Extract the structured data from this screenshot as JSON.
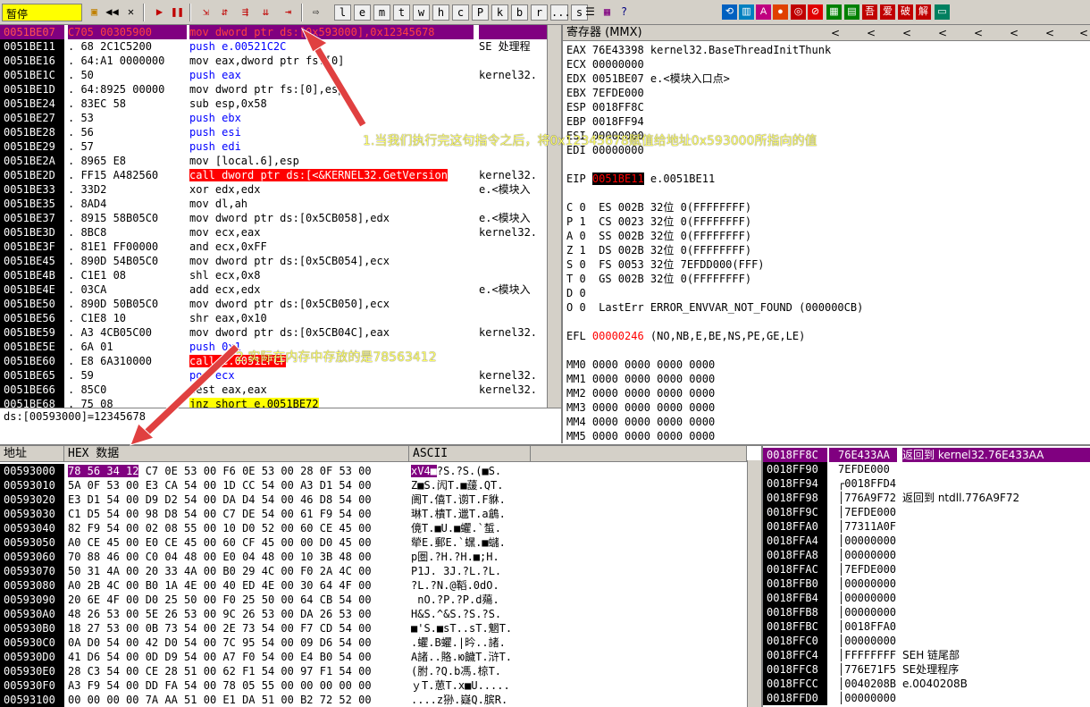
{
  "toolbar": {
    "status": "暂停",
    "letters": [
      "l",
      "e",
      "m",
      "t",
      "w",
      "h",
      "c",
      "P",
      "k",
      "b",
      "r",
      "...",
      "s"
    ],
    "cn_buttons": [
      "吾",
      "爱",
      "破",
      "解"
    ]
  },
  "cpu": {
    "rows": [
      {
        "addr": "0051BE07",
        "hex": "C705 00305900",
        "ins": "mov dword ptr ds:[0x593000],0x12345678",
        "ins_color": "",
        "com": "",
        "sel": true
      },
      {
        "addr": "0051BE11",
        "hex": ". 68 2C1C5200",
        "ins": "push e.00521C2C",
        "ins_color": "blue",
        "com": "SE 处理程",
        "sel": false
      },
      {
        "addr": "0051BE16",
        "hex": ". 64:A1 0000000",
        "ins": "mov eax,dword ptr fs:[0]",
        "ins_color": "",
        "com": "",
        "sel": false
      },
      {
        "addr": "0051BE1C",
        "hex": ". 50",
        "ins": "push eax",
        "ins_color": "blue",
        "com": "kernel32.",
        "sel": false
      },
      {
        "addr": "0051BE1D",
        "hex": ". 64:8925 00000",
        "ins": "mov dword ptr fs:[0],esp",
        "ins_color": "",
        "com": "",
        "sel": false
      },
      {
        "addr": "0051BE24",
        "hex": ". 83EC 58",
        "ins": "sub esp,0x58",
        "ins_color": "",
        "com": "",
        "sel": false
      },
      {
        "addr": "0051BE27",
        "hex": ". 53",
        "ins": "push ebx",
        "ins_color": "blue",
        "com": "",
        "sel": false
      },
      {
        "addr": "0051BE28",
        "hex": ". 56",
        "ins": "push esi",
        "ins_color": "blue",
        "com": "",
        "sel": false
      },
      {
        "addr": "0051BE29",
        "hex": ". 57",
        "ins": "push edi",
        "ins_color": "blue",
        "com": "",
        "sel": false
      },
      {
        "addr": "0051BE2A",
        "hex": ". 8965 E8",
        "ins": "mov [local.6],esp",
        "ins_color": "",
        "com": "",
        "sel": false
      },
      {
        "addr": "0051BE2D",
        "hex": ". FF15 A482560",
        "ins": "call dword ptr ds:[<&KERNEL32.GetVersion",
        "ins_color": "call",
        "com": "kernel32.",
        "sel": false
      },
      {
        "addr": "0051BE33",
        "hex": ". 33D2",
        "ins": "xor edx,edx",
        "ins_color": "",
        "com": "e.<模块入",
        "sel": false
      },
      {
        "addr": "0051BE35",
        "hex": ". 8AD4",
        "ins": "mov dl,ah",
        "ins_color": "",
        "com": "",
        "sel": false
      },
      {
        "addr": "0051BE37",
        "hex": ". 8915 58B05C0",
        "ins": "mov dword ptr ds:[0x5CB058],edx",
        "ins_color": "",
        "com": "e.<模块入",
        "sel": false
      },
      {
        "addr": "0051BE3D",
        "hex": ". 8BC8",
        "ins": "mov ecx,eax",
        "ins_color": "",
        "com": "kernel32.",
        "sel": false
      },
      {
        "addr": "0051BE3F",
        "hex": ". 81E1 FF00000",
        "ins": "and ecx,0xFF",
        "ins_color": "",
        "com": "",
        "sel": false
      },
      {
        "addr": "0051BE45",
        "hex": ". 890D 54B05C0",
        "ins": "mov dword ptr ds:[0x5CB054],ecx",
        "ins_color": "",
        "com": "",
        "sel": false
      },
      {
        "addr": "0051BE4B",
        "hex": ". C1E1 08",
        "ins": "shl ecx,0x8",
        "ins_color": "",
        "com": "",
        "sel": false
      },
      {
        "addr": "0051BE4E",
        "hex": ". 03CA",
        "ins": "add ecx,edx",
        "ins_color": "",
        "com": "e.<模块入",
        "sel": false
      },
      {
        "addr": "0051BE50",
        "hex": ". 890D 50B05C0",
        "ins": "mov dword ptr ds:[0x5CB050],ecx",
        "ins_color": "",
        "com": "",
        "sel": false
      },
      {
        "addr": "0051BE56",
        "hex": ". C1E8 10",
        "ins": "shr eax,0x10",
        "ins_color": "",
        "com": "",
        "sel": false
      },
      {
        "addr": "0051BE59",
        "hex": ". A3 4CB05C00",
        "ins": "mov dword ptr ds:[0x5CB04C],eax",
        "ins_color": "",
        "com": "kernel32.",
        "sel": false
      },
      {
        "addr": "0051BE5E",
        "hex": ". 6A 01",
        "ins": "push 0x1",
        "ins_color": "blue",
        "com": "",
        "sel": false
      },
      {
        "addr": "0051BE60",
        "hex": ". E8 6A310000",
        "ins": "call e.0051EFCF",
        "ins_color": "call",
        "com": "",
        "sel": false
      },
      {
        "addr": "0051BE65",
        "hex": ". 59",
        "ins": "pop ecx",
        "ins_color": "blue",
        "com": "kernel32.",
        "sel": false
      },
      {
        "addr": "0051BE66",
        "hex": ". 85C0",
        "ins": "test eax,eax",
        "ins_color": "",
        "com": "kernel32.",
        "sel": false
      },
      {
        "addr": "0051BE68",
        "hex": ". 75 08",
        "ins": "jnz short e.0051BE72",
        "ins_color": "jmp",
        "com": "",
        "sel": false
      }
    ],
    "info": "ds:[00593000]=12345678"
  },
  "registers": {
    "title": "寄存器 (MMX)",
    "lines": [
      {
        "text": "EAX 76E43398 kernel32.BaseThreadInitThunk",
        "red": ""
      },
      {
        "text": "ECX 00000000",
        "red": ""
      },
      {
        "text": "EDX 0051BE07 e.<模块入口点>",
        "red": ""
      },
      {
        "text": "EBX 7EFDE000",
        "red": ""
      },
      {
        "text": "ESP 0018FF8C",
        "red": ""
      },
      {
        "text": "EBP 0018FF94",
        "red": ""
      },
      {
        "text": "ESI 00000000",
        "red": ""
      },
      {
        "text": "EDI 00000000",
        "red": ""
      },
      {
        "text": "",
        "red": ""
      },
      {
        "text": "EIP 0051BE11 e.0051BE11",
        "red": "eip"
      },
      {
        "text": "",
        "red": ""
      },
      {
        "text": "C 0  ES 002B 32位 0(FFFFFFFF)",
        "red": ""
      },
      {
        "text": "P 1  CS 0023 32位 0(FFFFFFFF)",
        "red": ""
      },
      {
        "text": "A 0  SS 002B 32位 0(FFFFFFFF)",
        "red": ""
      },
      {
        "text": "Z 1  DS 002B 32位 0(FFFFFFFF)",
        "red": ""
      },
      {
        "text": "S 0  FS 0053 32位 7EFDD000(FFF)",
        "red": ""
      },
      {
        "text": "T 0  GS 002B 32位 0(FFFFFFFF)",
        "red": ""
      },
      {
        "text": "D 0",
        "red": ""
      },
      {
        "text": "O 0  LastErr ERROR_ENVVAR_NOT_FOUND (000000CB)",
        "red": ""
      },
      {
        "text": "",
        "red": ""
      },
      {
        "text": "EFL 00000246 (NO,NB,E,BE,NS,PE,GE,LE)",
        "red": "efl"
      },
      {
        "text": "",
        "red": ""
      },
      {
        "text": "MM0 0000 0000 0000 0000",
        "red": ""
      },
      {
        "text": "MM1 0000 0000 0000 0000",
        "red": ""
      },
      {
        "text": "MM2 0000 0000 0000 0000",
        "red": ""
      },
      {
        "text": "MM3 0000 0000 0000 0000",
        "red": ""
      },
      {
        "text": "MM4 0000 0000 0000 0000",
        "red": ""
      },
      {
        "text": "MM5 0000 0000 0000 0000",
        "red": ""
      },
      {
        "text": "MM6 0000 0000 0000 0000",
        "red": ""
      },
      {
        "text": "MM7 0000 0000 0000 0000",
        "red": ""
      }
    ]
  },
  "dump": {
    "headers": {
      "addr": "地址",
      "hex": "HEX 数据",
      "ascii": "ASCII"
    },
    "rows": [
      {
        "addr": "00593000",
        "hex": "78 56 34 12 C7 0E 53 00 F6 0E 53 00 28 0F 53 00",
        "ascii": "xV4■?S.?S.(■S."
      },
      {
        "addr": "00593010",
        "hex": "5A 0F 53 00 E3 CA 54 00 1D CC 54 00 A3 D1 54 00",
        "ascii": "Z■S.闶T.■蘐.QT."
      },
      {
        "addr": "00593020",
        "hex": "E3 D1 54 00 D9 D2 54 00 DA D4 54 00 46 D8 54 00",
        "ascii": "阓T.僖T.谫T.F貅."
      },
      {
        "addr": "00593030",
        "hex": "C1 D5 54 00 98 D8 54 00 C7 DE 54 00 61 F9 54 00",
        "ascii": "琳T.樻T.邋T.a鶬."
      },
      {
        "addr": "00593040",
        "hex": "82 F9 54 00 02 08 55 00 10 D0 52 00 60 CE 45 00",
        "ascii": "傹T.■U.■蠷.`蜤."
      },
      {
        "addr": "00593050",
        "hex": "A0 CE 45 00 E0 CE 45 00 60 CF 45 00 00 D0 45 00",
        "ascii": "犖E.郵E.`蟔.■蠩."
      },
      {
        "addr": "00593060",
        "hex": "70 88 46 00 C0 04 48 00 E0 04 48 00 10 3B 48 00",
        "ascii": "p圏.?H.?H.■;H."
      },
      {
        "addr": "00593070",
        "hex": "50 31 4A 00 20 33 4A 00 B0 29 4C 00 F0 2A 4C 00",
        "ascii": "P1J. 3J.?L.?L."
      },
      {
        "addr": "00593080",
        "hex": "A0 2B 4C 00 B0 1A 4E 00 40 ED 4E 00 30 64 4F 00",
        "ascii": "?L.?N.@鞱.0dO."
      },
      {
        "addr": "00593090",
        "hex": "20 6E 4F 00 D0 25 50 00 F0 25 50 00 64 CB 54 00",
        "ascii": " nO.?P.?P.d薚."
      },
      {
        "addr": "005930A0",
        "hex": "48 26 53 00 5E 26 53 00 9C 26 53 00 DA 26 53 00",
        "ascii": "H&S.^&S.?S.?S."
      },
      {
        "addr": "005930B0",
        "hex": "18 27 53 00 0B 73 54 00 2E 73 54 00 F7 CD 54 00",
        "ascii": "■'S.■sT..sT.魍T."
      },
      {
        "addr": "005930C0",
        "hex": "0A D0 54 00 42 D0 54 00 7C 95 54 00 09 D6 54 00",
        "ascii": ".蠷.B蠷.|昑..諸."
      },
      {
        "addr": "005930D0",
        "hex": "41 D6 54 00 0D D9 54 00 A7 F0 54 00 E4 B0 54 00",
        "ascii": "A諸..賂.ю饖T.浒T."
      },
      {
        "addr": "005930E0",
        "hex": "28 C3 54 00 CE 28 51 00 62 F1 54 00 97 F1 54 00",
        "ascii": "(胕.?Q.b馮.椋T."
      },
      {
        "addr": "005930F0",
        "hex": "A3 F9 54 00 DD FA 54 00 78 05 55 00 00 00 00 00",
        "ascii": "ｙT.葸T.x■U....."
      },
      {
        "addr": "00593100",
        "hex": "00 00 00 00 7A AA 51 00 E1 DA 51 00 B2 72 52 00",
        "ascii": "....z狲.嶷Q.膑R."
      }
    ]
  },
  "stack": {
    "rows": [
      {
        "addr": "0018FF8C",
        "val": "76E433AA",
        "com": "返回到 kernel32.76E433AA",
        "top": true
      },
      {
        "addr": "0018FF90",
        "val": "7EFDE000",
        "com": "",
        "top": false
      },
      {
        "addr": "0018FF94",
        "val": "┌0018FFD4",
        "com": "",
        "top": false
      },
      {
        "addr": "0018FF98",
        "val": "│776A9F72",
        "com": "返回到 ntdll.776A9F72",
        "top": false
      },
      {
        "addr": "0018FF9C",
        "val": "│7EFDE000",
        "com": "",
        "top": false
      },
      {
        "addr": "0018FFA0",
        "val": "│77311A0F",
        "com": "",
        "top": false
      },
      {
        "addr": "0018FFA4",
        "val": "│00000000",
        "com": "",
        "top": false
      },
      {
        "addr": "0018FFA8",
        "val": "│00000000",
        "com": "",
        "top": false
      },
      {
        "addr": "0018FFAC",
        "val": "│7EFDE000",
        "com": "",
        "top": false
      },
      {
        "addr": "0018FFB0",
        "val": "│00000000",
        "com": "",
        "top": false
      },
      {
        "addr": "0018FFB4",
        "val": "│00000000",
        "com": "",
        "top": false
      },
      {
        "addr": "0018FFB8",
        "val": "│00000000",
        "com": "",
        "top": false
      },
      {
        "addr": "0018FFBC",
        "val": "│0018FFA0",
        "com": "",
        "top": false
      },
      {
        "addr": "0018FFC0",
        "val": "│00000000",
        "com": "",
        "top": false
      },
      {
        "addr": "0018FFC4",
        "val": "│FFFFFFFF",
        "com": "SEH 链尾部",
        "top": false
      },
      {
        "addr": "0018FFC8",
        "val": "│776E71F5",
        "com": "SE处理程序",
        "top": false
      },
      {
        "addr": "0018FFCC",
        "val": "│0040208B",
        "com": "e.0040208B",
        "top": false
      },
      {
        "addr": "0018FFD0",
        "val": "│00000000",
        "com": "",
        "top": false
      }
    ]
  },
  "annotations": {
    "note1": "1.当我们执行完这句指令之后，将0x12345678赋值给地址0x593000所指向的值",
    "note2": "2.实际在内存中存放的是78563412"
  },
  "colors": {
    "accent": "#800080",
    "arrow": "#e04040",
    "annotation": "#ffff66"
  }
}
